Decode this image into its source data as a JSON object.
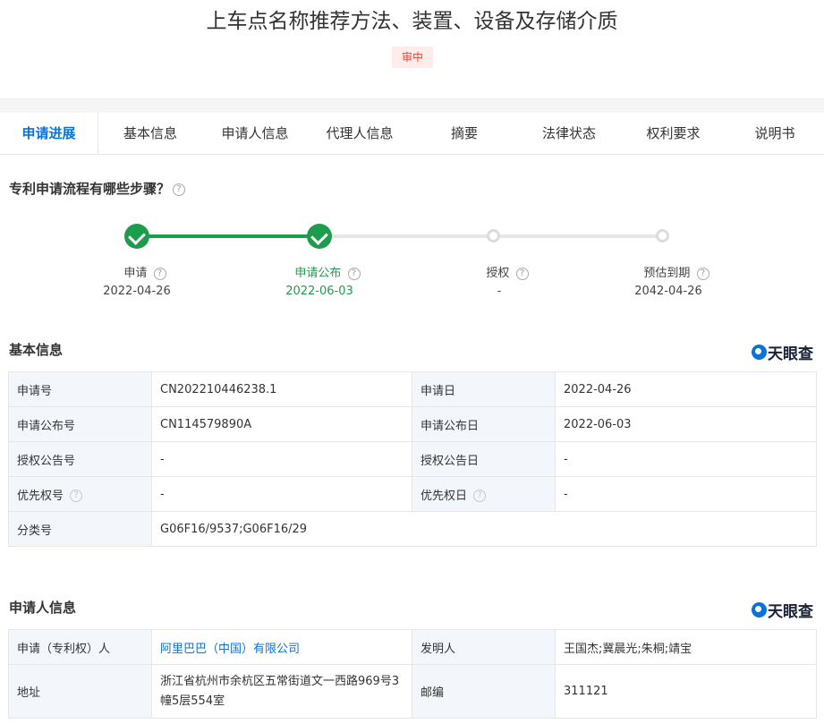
{
  "header": {
    "title": "上车点名称推荐方法、装置、设备及存储介质",
    "status": "审中"
  },
  "tabs": [
    "申请进展",
    "基本信息",
    "申请人信息",
    "代理人信息",
    "摘要",
    "法律状态",
    "权利要求",
    "说明书"
  ],
  "progress": {
    "title": "专利申请流程有哪些步骤？",
    "help": "?",
    "steps": [
      {
        "label": "申请",
        "date": "2022-04-26",
        "state": "done"
      },
      {
        "label": "申请公布",
        "date": "2022-06-03",
        "state": "current"
      },
      {
        "label": "授权",
        "date": "-",
        "state": "pending"
      },
      {
        "label": "预估到期",
        "date": "2042-04-26",
        "state": "pending"
      }
    ]
  },
  "basic_info": {
    "title": "基本信息",
    "logo": "天眼查",
    "rows": [
      {
        "k1": "申请号",
        "v1": "CN202210446238.1",
        "k2": "申请日",
        "v2": "2022-04-26"
      },
      {
        "k1": "申请公布号",
        "v1": "CN114579890A",
        "k2": "申请公布日",
        "v2": "2022-06-03"
      },
      {
        "k1": "授权公告号",
        "v1": "-",
        "k2": "授权公告日",
        "v2": "-"
      },
      {
        "k1": "优先权号",
        "v1": "-",
        "k2": "优先权日",
        "v2": "-"
      },
      {
        "k1": "分类号",
        "v1": "G06F16/9537;G06F16/29"
      }
    ]
  },
  "applicant_info": {
    "title": "申请人信息",
    "logo": "天眼查",
    "rows": [
      {
        "k1": "申请（专利权）人",
        "v1": "阿里巴巴（中国）有限公司",
        "k2": "发明人",
        "v2": "王国杰;冀晨光;朱桐;靖宝"
      },
      {
        "k1": "地址",
        "v1": "浙江省杭州市余杭区五常街道文一西路969号3幢5层554室",
        "k2": "邮编",
        "v2": "311121"
      }
    ]
  },
  "colors": {
    "accent": "#0a72d8",
    "done": "#1e9c4e",
    "badge_text": "#e0473f"
  }
}
